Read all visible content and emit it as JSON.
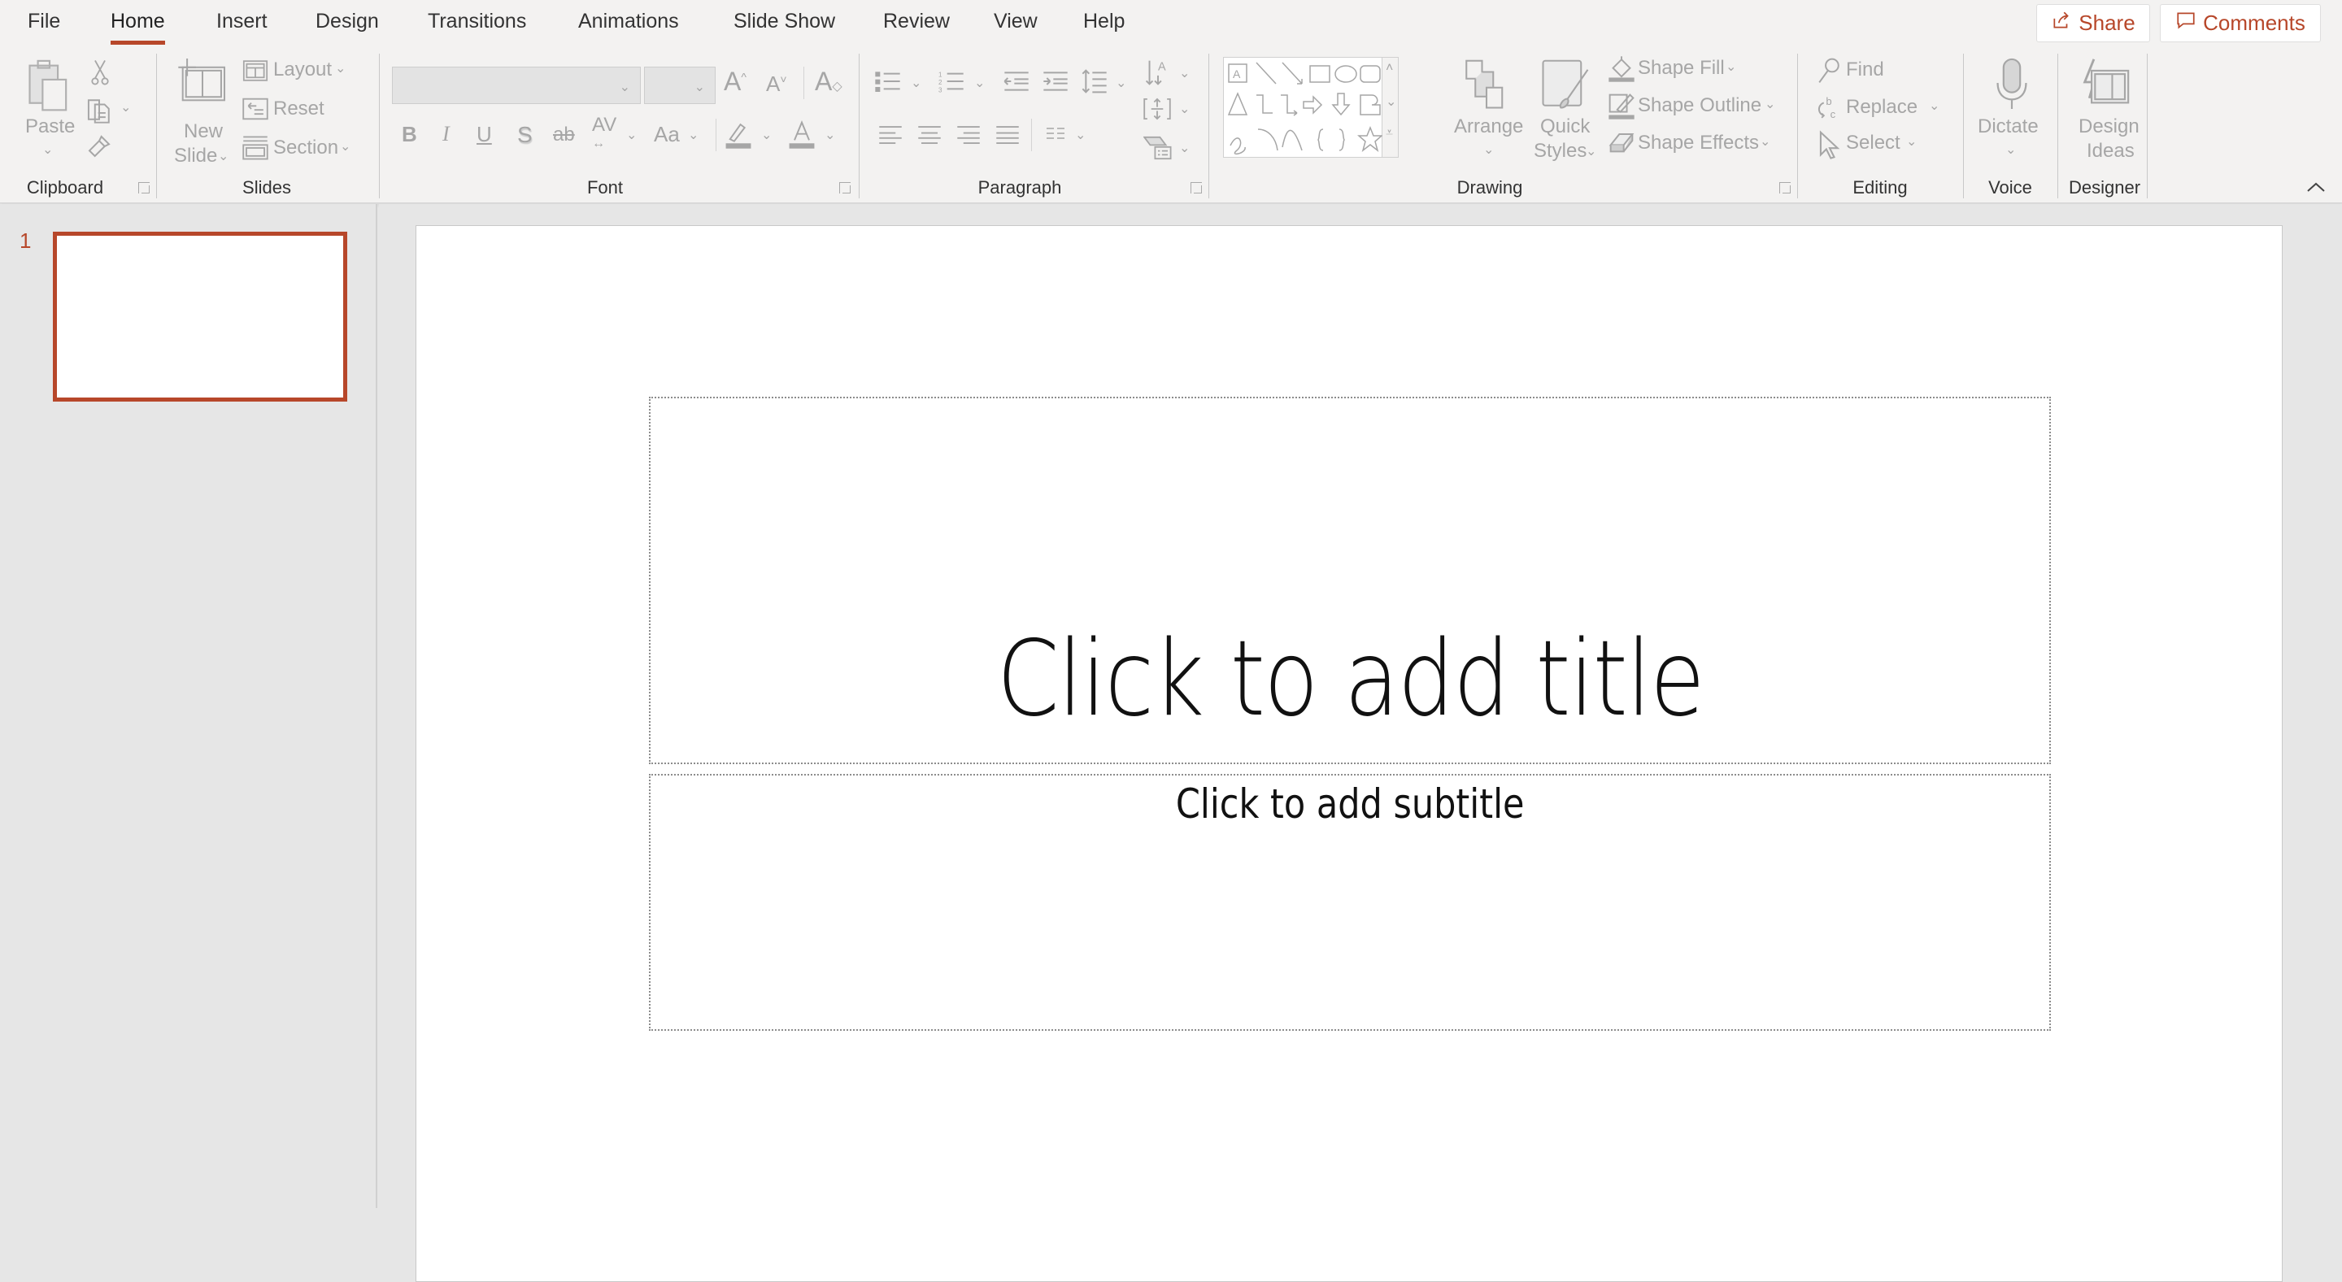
{
  "menubar": {
    "tabs": [
      {
        "label": "File"
      },
      {
        "label": "Home",
        "active": true
      },
      {
        "label": "Insert"
      },
      {
        "label": "Design"
      },
      {
        "label": "Transitions"
      },
      {
        "label": "Animations"
      },
      {
        "label": "Slide Show"
      },
      {
        "label": "Review"
      },
      {
        "label": "View"
      },
      {
        "label": "Help"
      }
    ],
    "share_label": "Share",
    "comments_label": "Comments"
  },
  "ribbon": {
    "clipboard": {
      "group_label": "Clipboard",
      "paste_label": "Paste"
    },
    "slides": {
      "group_label": "Slides",
      "new_slide_line1": "New",
      "new_slide_line2": "Slide",
      "layout_label": "Layout",
      "reset_label": "Reset",
      "section_label": "Section"
    },
    "font": {
      "group_label": "Font",
      "font_name_value": "",
      "font_size_value": ""
    },
    "paragraph": {
      "group_label": "Paragraph"
    },
    "drawing": {
      "group_label": "Drawing",
      "arrange_label": "Arrange",
      "quick_styles_line1": "Quick",
      "quick_styles_line2": "Styles",
      "shape_fill_label": "Shape Fill",
      "shape_outline_label": "Shape Outline",
      "shape_effects_label": "Shape Effects"
    },
    "editing": {
      "group_label": "Editing",
      "find_label": "Find",
      "replace_label": "Replace",
      "select_label": "Select"
    },
    "voice": {
      "group_label": "Voice",
      "dictate_label": "Dictate"
    },
    "designer": {
      "group_label": "Designer",
      "design_ideas_line1": "Design",
      "design_ideas_line2": "Ideas"
    }
  },
  "thumbnails": {
    "slides": [
      {
        "number": "1",
        "selected": true
      }
    ]
  },
  "slide": {
    "title_placeholder": "Click to add title",
    "subtitle_placeholder": "Click to add subtitle"
  },
  "colors": {
    "accent": "#b7472a",
    "ribbon_bg": "#f3f2f1",
    "disabled": "#a6a6a6"
  }
}
